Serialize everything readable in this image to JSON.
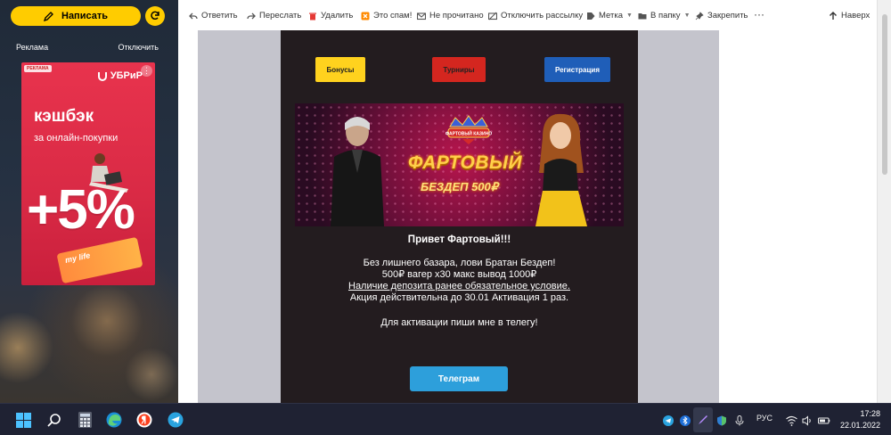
{
  "sidebar": {
    "compose_label": "Написать",
    "ad_label": "Реклама",
    "ad_disable": "Отключить",
    "ad": {
      "badge": "РЕКЛАМА",
      "brand": "УБРиР",
      "title": "кэшбэк",
      "subtitle": "за онлайн-покупки",
      "percent": "+5%",
      "card_text": "my life"
    }
  },
  "toolbar": {
    "reply": "Ответить",
    "forward": "Переслать",
    "delete": "Удалить",
    "spam": "Это спам!",
    "unread": "Не прочитано",
    "unsubscribe": "Отключить рассылку",
    "label": "Метка",
    "folder": "В папку",
    "pin": "Закрепить",
    "more": "···",
    "up": "Наверх"
  },
  "email": {
    "buttons": [
      "Бонусы",
      "Турниры",
      "Регистрация"
    ],
    "banner": {
      "title": "ФАРТОВЫЙ",
      "subtitle": "БЕЗДЕП 500₽",
      "logo_text": "ФАРТОВЫЙ КАЗИНО"
    },
    "greeting": "Привет Фартовый!!!",
    "lines": [
      "Без лишнего базара, лови Братан Бездеп!",
      "500₽ вагер х30 макс вывод 1000₽",
      "Наличие депозита ранее обязательное условие.",
      "Акция действительна до 30.01 Активация 1 раз."
    ],
    "telegram_text": "Для активации пиши мне в телегу!",
    "telegram_button": "Телеграм"
  },
  "taskbar": {
    "lang": "РУС",
    "time": "17:28",
    "date": "22.01.2022"
  },
  "colors": {
    "accent_yellow": "#ffcc00",
    "email_bg": "#231c1f",
    "telegram_blue": "#2d9fdb"
  }
}
